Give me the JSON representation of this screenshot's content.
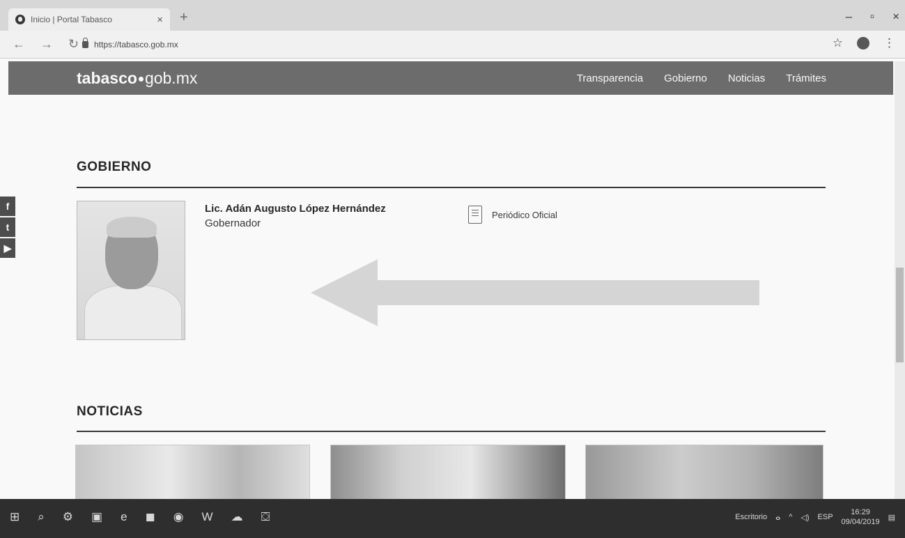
{
  "browser": {
    "tab_title": "Inicio | Portal Tabasco",
    "tab_close": "×",
    "new_tab": "+",
    "url": "https://tabasco.gob.mx",
    "window_buttons": [
      "–",
      "▫",
      "×"
    ]
  },
  "header": {
    "logo_bold": "tabasco",
    "logo_rest": "gob.mx",
    "nav": [
      "Transparencia",
      "Gobierno",
      "Noticias",
      "Trámites"
    ]
  },
  "social": [
    "f",
    "t",
    "▶"
  ],
  "gobierno": {
    "title": "GOBIERNO",
    "name": "Lic. Adán Augusto López Hernández",
    "role": "Gobernador",
    "link": "Periódico Oficial"
  },
  "noticias": {
    "title": "NOTICIAS"
  },
  "taskbar": {
    "desktop_label": "Escritorio",
    "lang": "ESP",
    "time": "16:29",
    "date": "09/04/2019"
  }
}
